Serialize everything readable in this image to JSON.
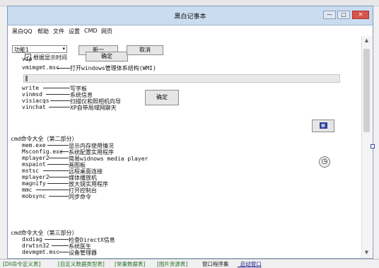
{
  "window": {
    "title": "黑白记事本",
    "min": "—",
    "max": "□",
    "close": "✕"
  },
  "menu": [
    "黑白QQ",
    "帮助",
    "文件",
    "设置",
    "CMD",
    "网页"
  ],
  "dropdown": {
    "value": "功能1"
  },
  "checkbox": {
    "label": "根据显示时间"
  },
  "buttons": {
    "jiao": "新一",
    "queding1": "确定",
    "quxiao": "取消",
    "queding2": "确定",
    "queding3": "确定"
  },
  "lines_part1": [
    {
      "cmd": "vip",
      "desc": ""
    },
    {
      "cmd": "vmimgmt.msc",
      "desc": "打开windows管理体系结构(WMI)"
    },
    {
      "cmd": "write",
      "desc": "写字板"
    },
    {
      "cmd": "vinmsd",
      "desc": "系统信息"
    },
    {
      "cmd": "visiacqs",
      "desc": "扫描仪和照相机向导"
    },
    {
      "cmd": "vinchat",
      "desc": "XP自带局域网聊天"
    }
  ],
  "section2": {
    "heading": "cmd命令大全（第二部分）",
    "lines": [
      {
        "cmd": "mem.exe",
        "desc": "显示内存使用情况"
      },
      {
        "cmd": "Msconfig.exe",
        "desc": "系统配置实用程序"
      },
      {
        "cmd": "mplayer2",
        "desc": "简易widnows media player"
      },
      {
        "cmd": "mspaint",
        "desc": "画图板"
      },
      {
        "cmd": "mstsc",
        "desc": "远程桌面连接"
      },
      {
        "cmd": "mplayer2",
        "desc": "媒体播放机"
      },
      {
        "cmd": "magnify",
        "desc": "放大镜实用程序"
      },
      {
        "cmd": "mmc",
        "desc": "打开控制台"
      },
      {
        "cmd": "mobsync",
        "desc": "同步命令"
      }
    ]
  },
  "section3": {
    "heading": "cmd命令大全（第三部分）",
    "lines": [
      {
        "cmd": "dxdiag",
        "desc": "检查DirectX信息"
      },
      {
        "cmd": "drwtsn32",
        "desc": "系统医生"
      },
      {
        "cmd": "devmgmt.msc",
        "desc": "设备管理器"
      }
    ]
  },
  "bottom_tabs": [
    "[Dll命令定义表]",
    "[自定义数据类型表]",
    "[常量数据表]",
    "[图片资源表]",
    "窗口程序集",
    "_启动窗口"
  ]
}
